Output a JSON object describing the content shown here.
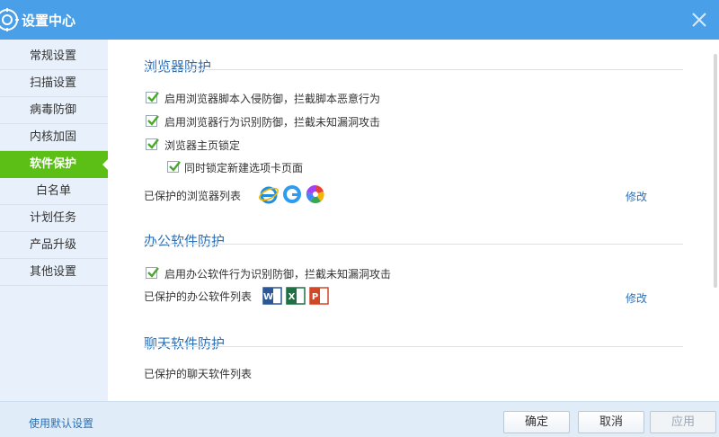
{
  "window": {
    "title": "设置中心"
  },
  "sidebar": {
    "items": [
      {
        "label": "常规设置"
      },
      {
        "label": "扫描设置"
      },
      {
        "label": "病毒防御"
      },
      {
        "label": "内核加固"
      },
      {
        "label": "软件保护",
        "active": true
      },
      {
        "label": "白名单"
      },
      {
        "label": "计划任务"
      },
      {
        "label": "产品升级"
      },
      {
        "label": "其他设置"
      }
    ]
  },
  "browser_section": {
    "title": "浏览器防护",
    "options": [
      {
        "label": "启用浏览器脚本入侵防御，拦截脚本恶意行为",
        "checked": true
      },
      {
        "label": "启用浏览器行为识别防御，拦截未知漏洞攻击",
        "checked": true
      },
      {
        "label": "浏览器主页锁定",
        "checked": true
      },
      {
        "label": "同时锁定新建选项卡页面",
        "checked": true
      }
    ],
    "list_label": "已保护的浏览器列表",
    "icons": [
      "ie-browser-icon",
      "edge-browser-icon",
      "360-browser-icon"
    ],
    "modify_label": "修改"
  },
  "office_section": {
    "title": "办公软件防护",
    "options": [
      {
        "label": "启用办公软件行为识别防御，拦截未知漏洞攻击",
        "checked": true
      }
    ],
    "list_label": "已保护的办公软件列表",
    "icons": [
      "word-icon",
      "excel-icon",
      "powerpoint-icon"
    ],
    "modify_label": "修改"
  },
  "chat_section": {
    "title": "聊天软件防护",
    "list_label": "已保护的聊天软件列表"
  },
  "footer": {
    "default_link": "使用默认设置",
    "ok_label": "确定",
    "cancel_label": "取消",
    "apply_label": "应用"
  },
  "colors": {
    "titlebar": "#4aa0e8",
    "active_nav": "#5cbf16",
    "accent_text": "#2d6fb5"
  }
}
